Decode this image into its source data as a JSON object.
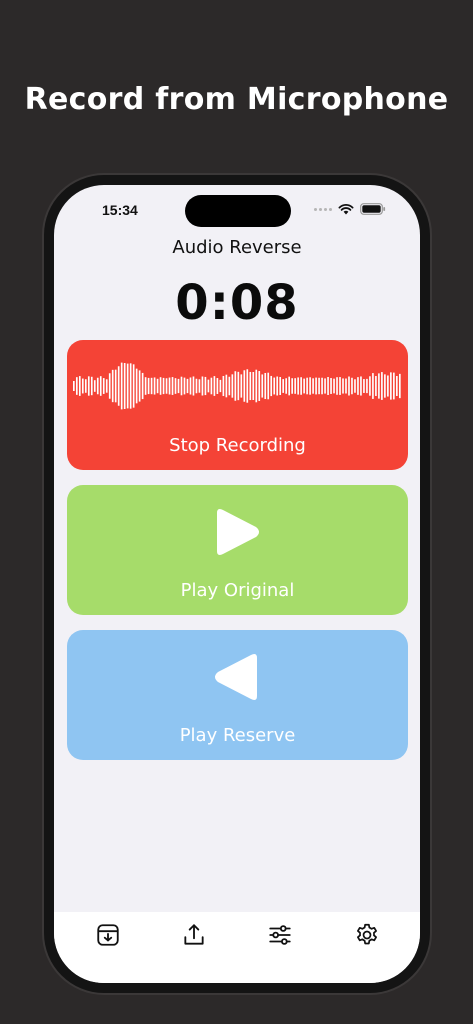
{
  "headline": "Record from Microphone",
  "status_bar": {
    "time": "15:34"
  },
  "app": {
    "title": "Audio Reverse",
    "timer": "0:08"
  },
  "buttons": {
    "stop_recording": "Stop Recording",
    "play_original": "Play Original",
    "play_reverse": "Play Reserve"
  },
  "colors": {
    "stop": "#f44336",
    "play": "#a6dc6a",
    "reverse": "#8fc5f2"
  },
  "tab_bar": {
    "items": [
      {
        "icon": "import-icon"
      },
      {
        "icon": "share-icon"
      },
      {
        "icon": "sliders-icon"
      },
      {
        "icon": "gear-icon"
      }
    ]
  }
}
